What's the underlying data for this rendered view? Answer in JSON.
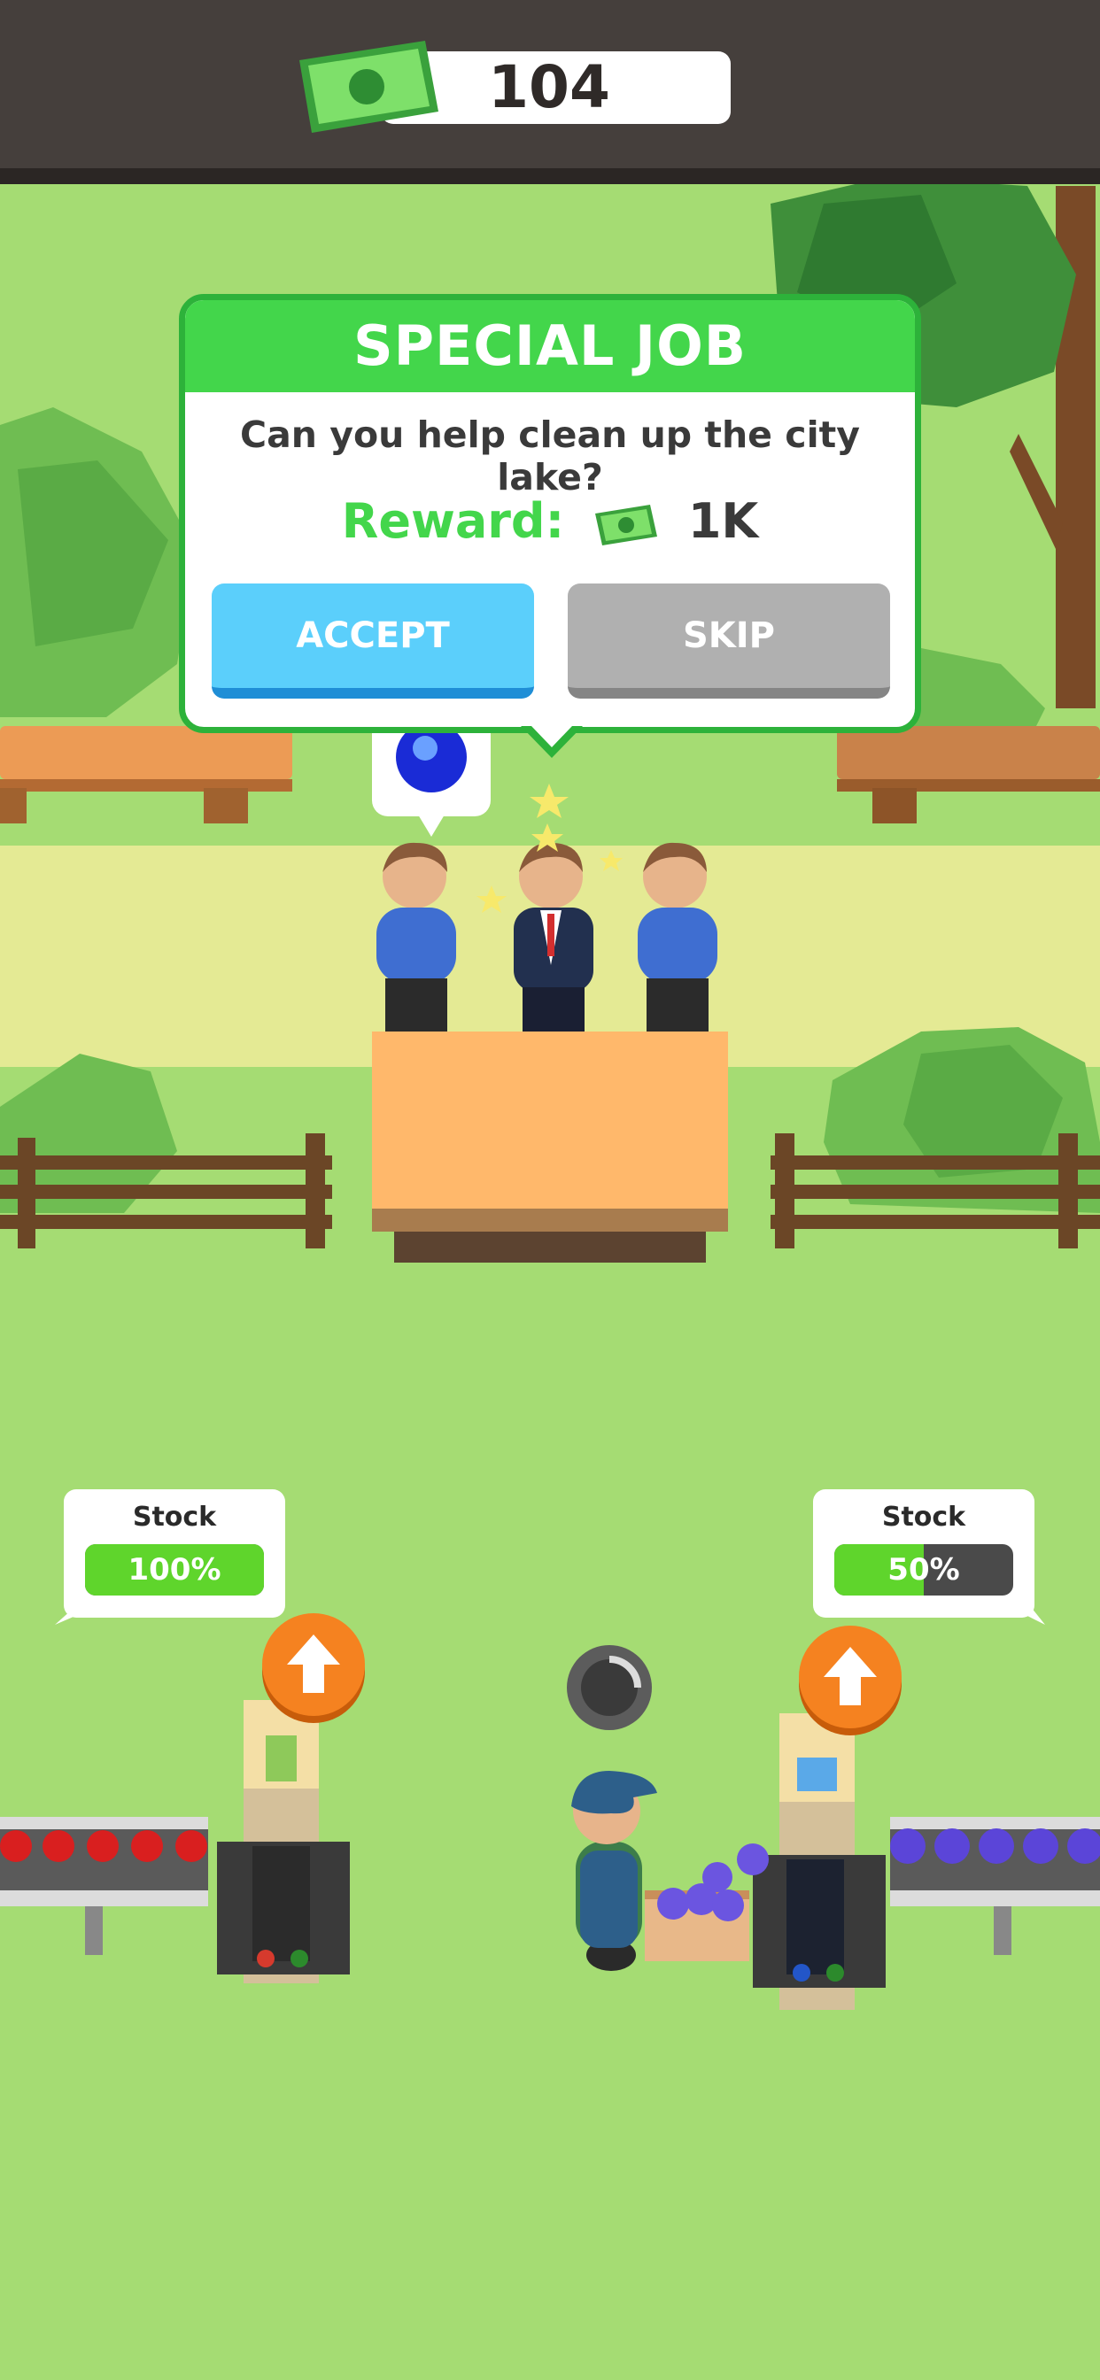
{
  "hud": {
    "money": "104",
    "money_icon": "cash-bill-icon",
    "bar_color": "#453f3c"
  },
  "special_job": {
    "title": "SPECIAL JOB",
    "message": "Can you help clean up the city lake?",
    "reward_label": "Reward:",
    "reward_amount": "1K",
    "accept_label": "ACCEPT",
    "skip_label": "SKIP",
    "accent": "#43d64b",
    "accept_color": "#5bcffb",
    "skip_color": "#b0b0b0"
  },
  "stock_left": {
    "label": "Stock",
    "percent_text": "100%",
    "level": 1.0
  },
  "stock_right": {
    "label": "Stock",
    "percent_text": "50%",
    "level": 0.5
  },
  "colors": {
    "grass": "#a5dc73",
    "path": "#e4ea94",
    "counter": "#ffb86b",
    "upgrade": "#f58220"
  }
}
